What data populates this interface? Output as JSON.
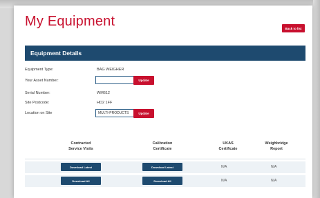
{
  "page": {
    "title": "My Equipment",
    "back_label": "Back to list"
  },
  "section": {
    "title": "Equipment Details"
  },
  "details": {
    "type_label": "Equipment Type:",
    "type_value": "BAG WEIGHER",
    "asset_label": "Your Asset Number:",
    "asset_value": "",
    "serial_label": "Serial Number:",
    "serial_value": "WM612",
    "postcode_label": "Site Postcode:",
    "postcode_value": "HD2 1FF",
    "location_label": "Location on Site",
    "location_value": "MULTI-PRODUCTS",
    "update_label": "Update"
  },
  "table": {
    "headers": [
      {
        "line1": "Contracted",
        "line2": "Service Visits"
      },
      {
        "line1": "Calibration",
        "line2": "Certificate"
      },
      {
        "line1": "UKAS",
        "line2": "Certificate"
      },
      {
        "line1": "Weighbridge",
        "line2": "Report"
      }
    ],
    "rows": [
      {
        "col1": "Download Latest",
        "col2": "Download Latest",
        "col3": "N/A",
        "col4": "N/A"
      },
      {
        "col1": "Download All",
        "col2": "Download All",
        "col3": "N/A",
        "col4": "N/A"
      }
    ]
  },
  "colors": {
    "accent_red": "#c8102e",
    "navy": "#1e4a6f",
    "row_tint": "#edf2f6"
  }
}
